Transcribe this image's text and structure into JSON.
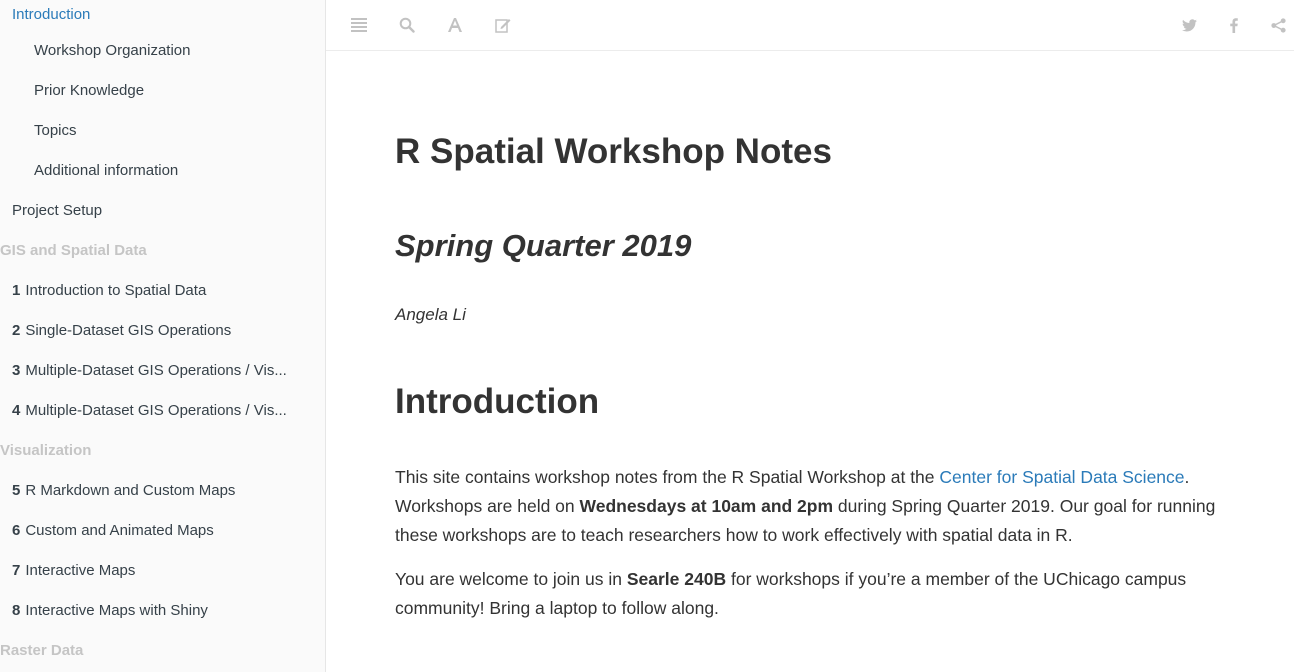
{
  "sidebar": {
    "items": [
      {
        "label": "Introduction",
        "level": 0,
        "active": true
      },
      {
        "label": "Workshop Organization",
        "level": 1
      },
      {
        "label": "Prior Knowledge",
        "level": 1
      },
      {
        "label": "Topics",
        "level": 1
      },
      {
        "label": "Additional information",
        "level": 1
      },
      {
        "label": "Project Setup",
        "level": 0
      },
      {
        "label": "GIS and Spatial Data",
        "header": true
      },
      {
        "num": "1",
        "label": "Introduction to Spatial Data",
        "level": 0
      },
      {
        "num": "2",
        "label": "Single-Dataset GIS Operations",
        "level": 0
      },
      {
        "num": "3",
        "label": "Multiple-Dataset GIS Operations / Vis...",
        "level": 0
      },
      {
        "num": "4",
        "label": "Multiple-Dataset GIS Operations / Vis...",
        "level": 0
      },
      {
        "label": "Visualization",
        "header": true
      },
      {
        "num": "5",
        "label": "R Markdown and Custom Maps",
        "level": 0
      },
      {
        "num": "6",
        "label": "Custom and Animated Maps",
        "level": 0
      },
      {
        "num": "7",
        "label": "Interactive Maps",
        "level": 0
      },
      {
        "num": "8",
        "label": "Interactive Maps with Shiny",
        "level": 0
      },
      {
        "label": "Raster Data",
        "header": true
      }
    ]
  },
  "toolbar": {
    "left_icons": [
      "toggle-sidebar-icon",
      "search-icon",
      "font-settings-icon",
      "edit-icon"
    ],
    "right_icons": [
      "twitter-icon",
      "facebook-icon",
      "share-icon"
    ],
    "icon_color": "#c2c2c2"
  },
  "main": {
    "title": "R Spatial Workshop Notes",
    "subtitle": "Spring Quarter 2019",
    "author": "Angela Li",
    "section_heading": "Introduction",
    "p1": {
      "t1": "This site contains workshop notes from the R Spatial Workshop at the ",
      "link": "Center for Spatial Data Science",
      "t2": ". Workshops are held on ",
      "bold": "Wednesdays at 10am and 2pm",
      "t3": " during Spring Quarter 2019. Our goal for running these workshops are to teach researchers how to work effectively with spatial data in R."
    },
    "p2": {
      "t1": "You are welcome to join us in ",
      "bold": "Searle 240B",
      "t2": " for workshops if you’re a member of the UChicago campus community! Bring a laptop to follow along."
    }
  },
  "colors": {
    "link": "#2b7bb9",
    "sidebar_bg": "#fafafa",
    "sidebar_header": "#c5c5c5",
    "text": "#333333"
  }
}
